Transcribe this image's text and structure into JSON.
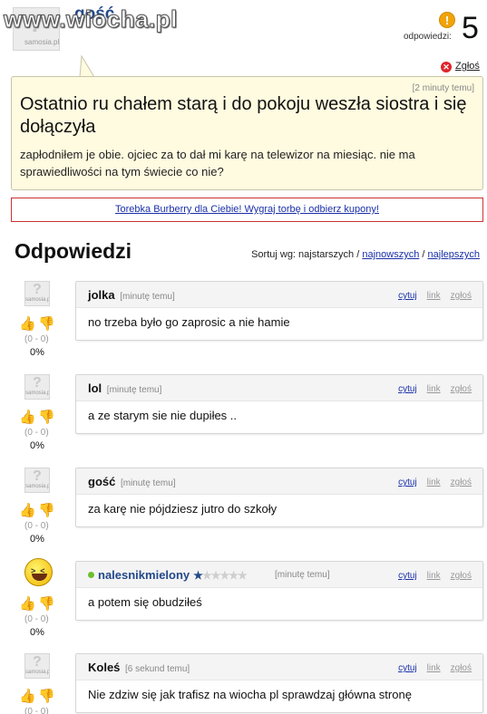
{
  "header": {
    "watermark": "www.wiocha.pl",
    "username": "gość",
    "avatar_caption": "samosia.pl",
    "answers_label": "odpowiedzi:",
    "answers_count": "5",
    "report_label": "Zgłoś"
  },
  "question": {
    "time": "[2 minuty temu]",
    "title": "Ostatnio ru chałem starą i do pokoju weszła siostra i się dołączyła",
    "body": "zapłodniłem je obie. ojciec za to dał mi karę na telewizor na miesiąc. nie ma sprawiedliwości na tym świecie co nie?"
  },
  "ad": {
    "text": "Torebka Burberry dla Ciebie! Wygraj torbę i odbierz kupony!"
  },
  "answers_section": {
    "title": "Odpowiedzi",
    "sort_prefix": "Sortuj wg: najstarszych / ",
    "sort_newest": "najnowszych",
    "sort_sep": " / ",
    "sort_best": "najlepszych"
  },
  "actions": {
    "quote": "cytuj",
    "link": "link",
    "report": "zgłoś"
  },
  "answers": [
    {
      "user": "jolka",
      "time": "[minutę temu]",
      "text": "no trzeba było go zaprosic a nie hamie",
      "votes": "(0 - 0)",
      "percent": "0%"
    },
    {
      "user": "lol",
      "time": "[minutę temu]",
      "text": "a ze starym sie nie dupiłes ..",
      "votes": "(0 - 0)",
      "percent": "0%"
    },
    {
      "user": "gość",
      "time": "[minutę temu]",
      "text": "za karę nie pójdziesz jutro do szkoły",
      "votes": "(0 - 0)",
      "percent": "0%"
    },
    {
      "user": "nalesnikmielony",
      "time": "[minutę temu]",
      "text": "a potem się obudziłeś",
      "votes": "(0 - 0)",
      "percent": "0%",
      "rating_stars": 0.5
    },
    {
      "user": "Koleś",
      "time": "[6 sekund temu]",
      "text": "Nie zdziw się jak trafisz na wiocha pl sprawdzaj główna stronę",
      "votes": "(0 - 0)",
      "percent": ""
    }
  ]
}
